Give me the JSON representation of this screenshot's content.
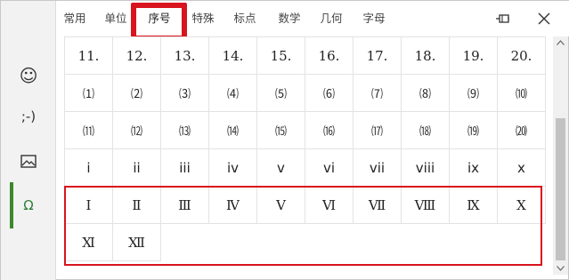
{
  "tabs": [
    {
      "label": "常用",
      "active": false
    },
    {
      "label": "单位",
      "active": false
    },
    {
      "label": "序号",
      "active": true
    },
    {
      "label": "特殊",
      "active": false
    },
    {
      "label": "标点",
      "active": false
    },
    {
      "label": "数学",
      "active": false
    },
    {
      "label": "几何",
      "active": false
    },
    {
      "label": "字母",
      "active": false
    }
  ],
  "rail": {
    "items": [
      {
        "name": "emoji",
        "label": "☺",
        "icon": "smiley-icon",
        "active": false
      },
      {
        "name": "emoticon",
        "label": ";-)",
        "icon": null,
        "active": false
      },
      {
        "name": "image",
        "label": "",
        "icon": "image-icon",
        "active": false
      },
      {
        "name": "symbols",
        "label": "Ω",
        "icon": "omega-icon",
        "active": true
      }
    ]
  },
  "symbols": {
    "rows": [
      [
        "11.",
        "12.",
        "13.",
        "14.",
        "15.",
        "16.",
        "17.",
        "18.",
        "19.",
        "20."
      ],
      [
        "⑴",
        "⑵",
        "⑶",
        "⑷",
        "⑸",
        "⑹",
        "⑺",
        "⑻",
        "⑼",
        "⑽"
      ],
      [
        "⑾",
        "⑿",
        "⒀",
        "⒁",
        "⒂",
        "⒃",
        "⒄",
        "⒅",
        "⒆",
        "⒇"
      ],
      [
        "i",
        "ii",
        "iii",
        "iv",
        "v",
        "vi",
        "vii",
        "viii",
        "ix",
        "x"
      ],
      [
        "Ⅰ",
        "Ⅱ",
        "Ⅲ",
        "Ⅳ",
        "Ⅴ",
        "Ⅵ",
        "Ⅶ",
        "Ⅷ",
        "Ⅸ",
        "Ⅹ"
      ],
      [
        "Ⅺ",
        "Ⅻ"
      ]
    ]
  },
  "colors": {
    "highlight": "#d8141e",
    "accent": "#3b8a2a"
  }
}
